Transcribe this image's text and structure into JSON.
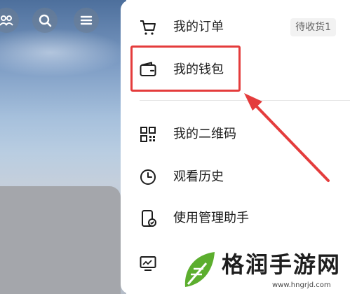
{
  "header": {
    "icons": [
      {
        "name": "friends-icon"
      },
      {
        "name": "search-icon"
      },
      {
        "name": "menu-icon"
      }
    ]
  },
  "menu": {
    "items": [
      {
        "label": "我的订单",
        "icon": "cart-icon",
        "badge": "待收货1"
      },
      {
        "label": "我的钱包",
        "icon": "wallet-icon",
        "badge": ""
      },
      {
        "label": "我的二维码",
        "icon": "qrcode-icon",
        "badge": ""
      },
      {
        "label": "观看历史",
        "icon": "clock-icon",
        "badge": ""
      },
      {
        "label": "使用管理助手",
        "icon": "phone-check-icon",
        "badge": ""
      }
    ]
  },
  "annotation": {
    "highlight_color": "#e43c3c",
    "highlighted_item": "我的钱包"
  },
  "watermark": {
    "text": "格润手游网",
    "url": "www.hngrjd.com"
  }
}
